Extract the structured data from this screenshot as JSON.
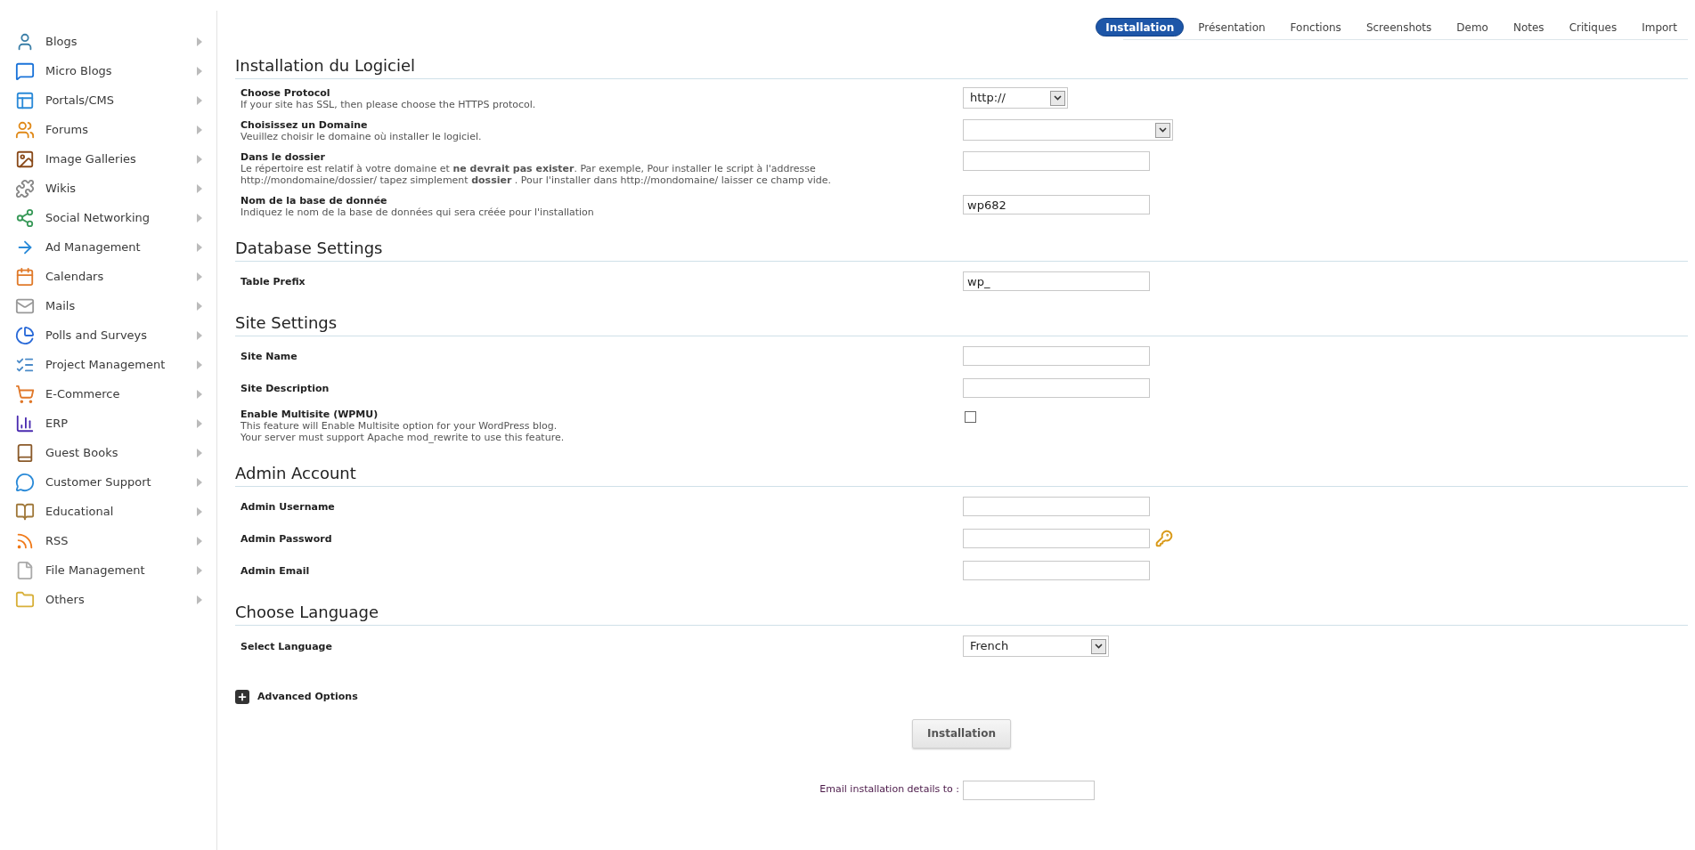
{
  "sidebar": {
    "items": [
      {
        "label": "Blogs"
      },
      {
        "label": "Micro Blogs"
      },
      {
        "label": "Portals/CMS"
      },
      {
        "label": "Forums"
      },
      {
        "label": "Image Galleries"
      },
      {
        "label": "Wikis"
      },
      {
        "label": "Social Networking"
      },
      {
        "label": "Ad Management"
      },
      {
        "label": "Calendars"
      },
      {
        "label": "Mails"
      },
      {
        "label": "Polls and Surveys"
      },
      {
        "label": "Project Management"
      },
      {
        "label": "E-Commerce"
      },
      {
        "label": "ERP"
      },
      {
        "label": "Guest Books"
      },
      {
        "label": "Customer Support"
      },
      {
        "label": "Educational"
      },
      {
        "label": "RSS"
      },
      {
        "label": "File Management"
      },
      {
        "label": "Others"
      }
    ]
  },
  "tabs": [
    {
      "label": "Installation",
      "selected": true
    },
    {
      "label": "Présentation",
      "selected": false
    },
    {
      "label": "Fonctions",
      "selected": false
    },
    {
      "label": "Screenshots",
      "selected": false
    },
    {
      "label": "Demo",
      "selected": false
    },
    {
      "label": "Notes",
      "selected": false
    },
    {
      "label": "Critiques",
      "selected": false
    },
    {
      "label": "Import",
      "selected": false
    }
  ],
  "sections": [
    {
      "title": "Installation du Logiciel",
      "fields": [
        {
          "kind": "select",
          "label": "Choose Protocol",
          "description": "If your site has SSL, then please choose the HTTPS protocol.",
          "value": "http://"
        },
        {
          "kind": "select",
          "label": "Choisissez un Domaine",
          "description": "Veuillez choisir le domaine où installer le logiciel."
        },
        {
          "kind": "text",
          "label": "Dans le dossier",
          "description": "Le répertoire est relatif à votre domaine et **ne devrait pas exister**. Par exemple, Pour installer le script à l'addresse http://mondomaine/dossier/ tapez simplement **dossier** . Pour l'installer dans http://mondomaine/ laisser ce champ vide."
        },
        {
          "kind": "text",
          "label": "Nom de la base de donnée",
          "description": "Indiquez le nom de la base de données qui sera créée pour l'installation",
          "value": "wp682"
        }
      ]
    },
    {
      "title": "Database Settings",
      "fields": [
        {
          "kind": "text",
          "label": "Table Prefix",
          "value": "wp_"
        }
      ]
    },
    {
      "title": "Site Settings",
      "fields": [
        {
          "kind": "text",
          "label": "Site Name"
        },
        {
          "kind": "text",
          "label": "Site Description"
        },
        {
          "kind": "checkbox",
          "label": "Enable Multisite (WPMU)",
          "description": "This feature will Enable Multisite option for your WordPress blog.\nYour server must support Apache mod_rewrite to use this feature.",
          "checked": false
        }
      ]
    },
    {
      "title": "Admin Account",
      "fields": [
        {
          "kind": "text",
          "label": "Admin Username"
        },
        {
          "kind": "password",
          "label": "Admin Password"
        },
        {
          "kind": "text",
          "label": "Admin Email"
        }
      ]
    },
    {
      "title": "Choose Language",
      "fields": [
        {
          "kind": "select",
          "label": "Select Language",
          "value": "French"
        }
      ]
    }
  ],
  "advanced_options": {
    "label": "Advanced Options",
    "expanded": false
  },
  "install_button": {
    "label": "Installation"
  },
  "email_details": {
    "label": "Email installation details to :"
  }
}
